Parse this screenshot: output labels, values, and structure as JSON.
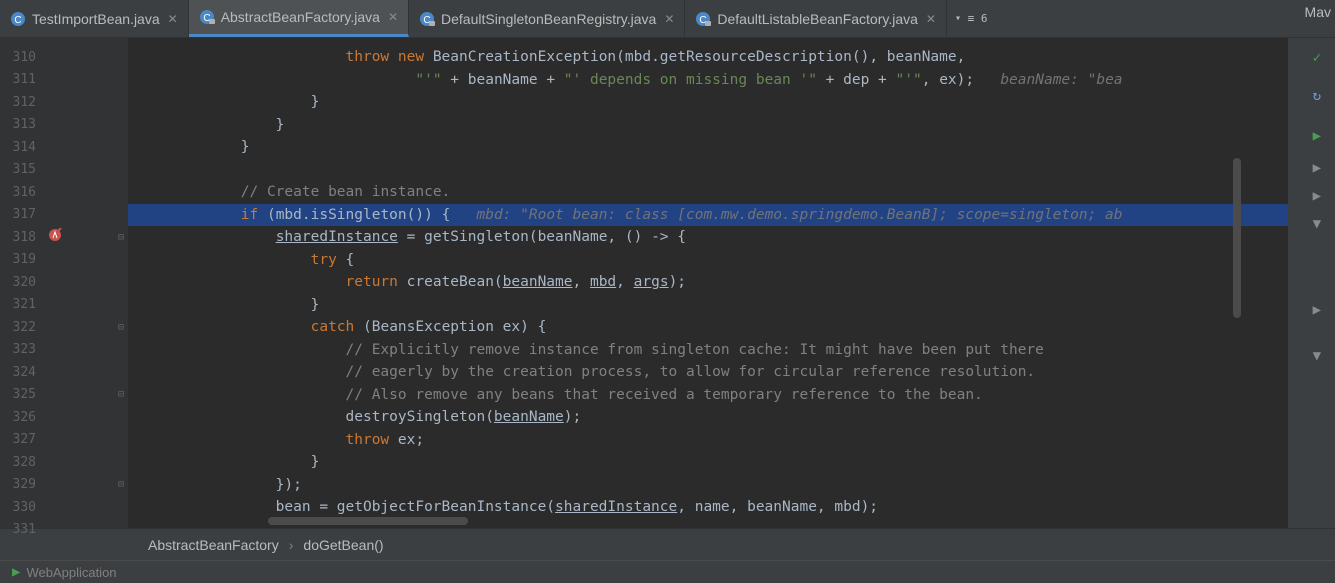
{
  "tabs": [
    {
      "label": "TestImportBean.java",
      "icon": "C",
      "iconColor": "#4a88c7",
      "active": false
    },
    {
      "label": "AbstractBeanFactory.java",
      "icon": "C",
      "iconColor": "#4a88c7",
      "active": true,
      "lock": true
    },
    {
      "label": "DefaultSingletonBeanRegistry.java",
      "icon": "C",
      "iconColor": "#4a88c7",
      "active": false,
      "lock": true
    },
    {
      "label": "DefaultListableBeanFactory.java",
      "icon": "C",
      "iconColor": "#4a88c7",
      "active": false,
      "lock": true
    }
  ],
  "tabMore": "≡ 6",
  "rightLabel": "Mav",
  "lines": {
    "310": {
      "tokens": [
        {
          "t": "                        ",
          "c": ""
        },
        {
          "t": "throw new ",
          "c": "kw"
        },
        {
          "t": "BeanCreationException(mbd.getResourceDescription(), beanName,",
          "c": ""
        }
      ]
    },
    "311": {
      "tokens": [
        {
          "t": "                                ",
          "c": ""
        },
        {
          "t": "\"'\"",
          "c": "str"
        },
        {
          "t": " + beanName + ",
          "c": ""
        },
        {
          "t": "\"' depends on missing bean '\"",
          "c": "str"
        },
        {
          "t": " + dep + ",
          "c": ""
        },
        {
          "t": "\"'\"",
          "c": "str"
        },
        {
          "t": ", ex);   ",
          "c": ""
        },
        {
          "t": "beanName: \"bea",
          "c": "hint"
        }
      ]
    },
    "312": {
      "tokens": [
        {
          "t": "                    }",
          "c": ""
        }
      ]
    },
    "313": {
      "tokens": [
        {
          "t": "                }",
          "c": ""
        }
      ]
    },
    "314": {
      "tokens": [
        {
          "t": "            }",
          "c": ""
        }
      ]
    },
    "315": {
      "tokens": [
        {
          "t": "",
          "c": ""
        }
      ]
    },
    "316": {
      "tokens": [
        {
          "t": "            ",
          "c": ""
        },
        {
          "t": "// Create bean instance.",
          "c": "comment"
        }
      ]
    },
    "317": {
      "highlight": true,
      "tokens": [
        {
          "t": "            ",
          "c": ""
        },
        {
          "t": "if ",
          "c": "kw"
        },
        {
          "t": "(mbd.isSingleton()) {   ",
          "c": ""
        },
        {
          "t": "mbd: \"Root bean: class [com.mw.demo.springdemo.BeanB]; scope=singleton; ab",
          "c": "hint"
        }
      ]
    },
    "318": {
      "tokens": [
        {
          "t": "                ",
          "c": ""
        },
        {
          "t": "sharedInstance",
          "c": "underline"
        },
        {
          "t": " = getSingleton(beanName, () -> {",
          "c": ""
        }
      ]
    },
    "319": {
      "tokens": [
        {
          "t": "                    ",
          "c": ""
        },
        {
          "t": "try ",
          "c": "kw"
        },
        {
          "t": "{",
          "c": ""
        }
      ]
    },
    "320": {
      "tokens": [
        {
          "t": "                        ",
          "c": ""
        },
        {
          "t": "return ",
          "c": "kw"
        },
        {
          "t": "createBean(",
          "c": ""
        },
        {
          "t": "beanName",
          "c": "underline"
        },
        {
          "t": ", ",
          "c": ""
        },
        {
          "t": "mbd",
          "c": "underline"
        },
        {
          "t": ", ",
          "c": ""
        },
        {
          "t": "args",
          "c": "underline"
        },
        {
          "t": ");",
          "c": ""
        }
      ]
    },
    "321": {
      "tokens": [
        {
          "t": "                    }",
          "c": ""
        }
      ]
    },
    "322": {
      "tokens": [
        {
          "t": "                    ",
          "c": ""
        },
        {
          "t": "catch ",
          "c": "kw"
        },
        {
          "t": "(BeansException ex) {",
          "c": ""
        }
      ]
    },
    "323": {
      "tokens": [
        {
          "t": "                        ",
          "c": ""
        },
        {
          "t": "// Explicitly remove instance from singleton cache: It might have been put there",
          "c": "comment"
        }
      ]
    },
    "324": {
      "tokens": [
        {
          "t": "                        ",
          "c": ""
        },
        {
          "t": "// eagerly by the creation process, to allow for circular reference resolution.",
          "c": "comment"
        }
      ]
    },
    "325": {
      "tokens": [
        {
          "t": "                        ",
          "c": ""
        },
        {
          "t": "// Also remove any beans that received a temporary reference to the bean.",
          "c": "comment"
        }
      ]
    },
    "326": {
      "tokens": [
        {
          "t": "                        destroySingleton(",
          "c": ""
        },
        {
          "t": "beanName",
          "c": "underline"
        },
        {
          "t": ");",
          "c": ""
        }
      ]
    },
    "327": {
      "tokens": [
        {
          "t": "                        ",
          "c": ""
        },
        {
          "t": "throw ",
          "c": "kw"
        },
        {
          "t": "ex;",
          "c": ""
        }
      ]
    },
    "328": {
      "tokens": [
        {
          "t": "                    }",
          "c": ""
        }
      ]
    },
    "329": {
      "tokens": [
        {
          "t": "                });",
          "c": ""
        }
      ]
    },
    "330": {
      "tokens": [
        {
          "t": "                bean = getObjectForBeanInstance(",
          "c": ""
        },
        {
          "t": "sharedInstance",
          "c": "underline"
        },
        {
          "t": ", name, beanName, mbd);",
          "c": ""
        }
      ]
    },
    "331": {
      "tokens": [
        {
          "t": "",
          "c": ""
        }
      ]
    }
  },
  "lineNumbers": [
    "310",
    "311",
    "312",
    "313",
    "314",
    "315",
    "316",
    "317",
    "318",
    "319",
    "320",
    "321",
    "322",
    "323",
    "324",
    "325",
    "326",
    "327",
    "328",
    "329",
    "330",
    "331"
  ],
  "breadcrumb": {
    "class": "AbstractBeanFactory",
    "method": "doGetBean()"
  },
  "bottomLabel": "WebApplication"
}
